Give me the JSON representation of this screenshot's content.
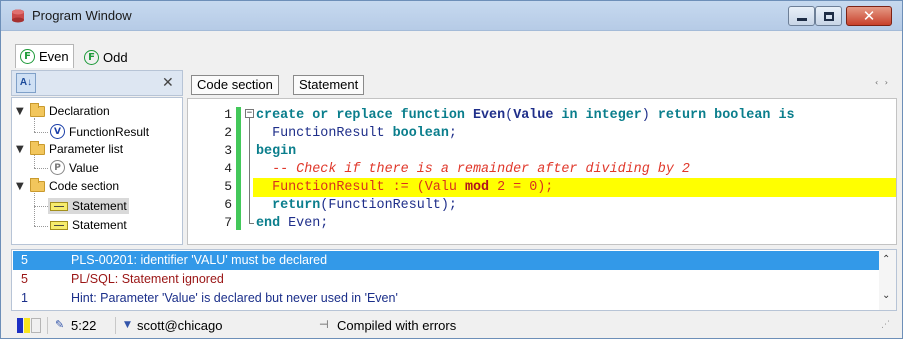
{
  "window": {
    "title": "Program Window",
    "controls": {
      "minimize": "",
      "maximize": "",
      "close": "✕"
    }
  },
  "tabs": [
    {
      "label": "Even",
      "icon": "function-icon",
      "active": true
    },
    {
      "label": "Odd",
      "icon": "function-icon",
      "active": false
    }
  ],
  "tree_panel": {
    "sort_icon": "A↓",
    "close": "✕",
    "nodes": [
      {
        "label": "Declaration",
        "type": "folder",
        "expanded": true
      },
      {
        "label": "FunctionResult",
        "type": "variable",
        "badge": "V"
      },
      {
        "label": "Parameter list",
        "type": "folder",
        "expanded": true
      },
      {
        "label": "Value",
        "type": "parameter",
        "badge": "P"
      },
      {
        "label": "Code section",
        "type": "folder",
        "expanded": true
      },
      {
        "label": "Statement",
        "type": "statement",
        "selected": true
      },
      {
        "label": "Statement",
        "type": "statement",
        "selected": false
      }
    ]
  },
  "editor": {
    "breadcrumb": [
      "Code section",
      "Statement"
    ],
    "nav": "‹ ›",
    "fold_marker": "−",
    "line_numbers": [
      "1",
      "2",
      "3",
      "4",
      "5",
      "6",
      "7"
    ],
    "highlighted_line": 5,
    "lines": {
      "l1": {
        "create_or_replace_function": "create or replace function",
        "name": "Even",
        "open": "(",
        "param": "Value",
        "in": "in",
        "integer": "integer",
        "close": ")",
        "return": "return",
        "boolean": "boolean",
        "is": "is"
      },
      "l2": {
        "indent": "  ",
        "var": "FunctionResult",
        "type": "boolean",
        "semi": ";"
      },
      "l3": {
        "begin": "begin"
      },
      "l4": {
        "comment": "  -- Check if there is a remainder after dividing by 2"
      },
      "l5": {
        "pre": "  FunctionResult := (Valu ",
        "mod": "mod",
        "post": " 2 = 0);"
      },
      "l6": {
        "indent": "  ",
        "return": "return",
        "rest": "(FunctionResult);"
      },
      "l7": {
        "end": "end",
        "rest": " Even;"
      }
    }
  },
  "messages": [
    {
      "line": "5",
      "text": "PLS-00201: identifier 'VALU' must be declared",
      "selected": true,
      "color": "#3399e8"
    },
    {
      "line": "5",
      "text": "PL/SQL: Statement ignored",
      "selected": false,
      "color": "#9a1515"
    },
    {
      "line": "1",
      "text": "Hint: Parameter 'Value' is declared but never used in 'Even'",
      "selected": false,
      "color": "#1b2f8a"
    }
  ],
  "scroll": {
    "up": "⌃",
    "down": "⌄"
  },
  "status_bar": {
    "cursor": "5:22",
    "cursor_icon": "pencil-icon",
    "connection": "scott@chicago",
    "connection_icon": "connection-icon",
    "compile_status": "Compiled with errors",
    "compile_icon": "pin-icon",
    "grip": "⋰"
  },
  "colors": {
    "keyword": "#0a7e8c",
    "identifier": "#1f2f8a",
    "comment": "#e0382b",
    "highlight": "#ffff00",
    "selection": "#3399e8",
    "modified_bar": "#43c85a"
  }
}
